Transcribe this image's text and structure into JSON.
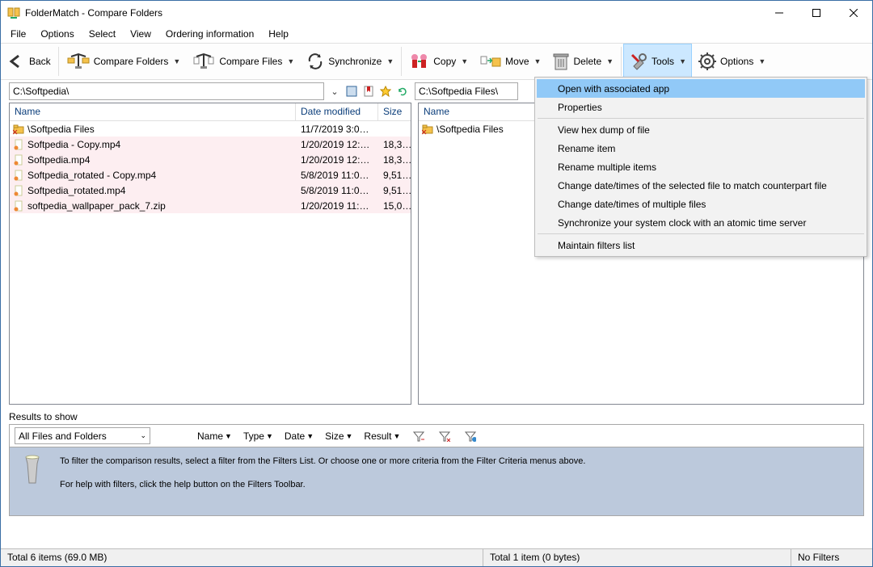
{
  "window": {
    "title": "FolderMatch - Compare Folders"
  },
  "menubar": [
    "File",
    "Options",
    "Select",
    "View",
    "Ordering information",
    "Help"
  ],
  "toolbar": {
    "back": "Back",
    "compare_folders": "Compare Folders",
    "compare_files": "Compare Files",
    "synchronize": "Synchronize",
    "copy": "Copy",
    "move": "Move",
    "delete": "Delete",
    "tools": "Tools",
    "options": "Options"
  },
  "paths": {
    "left": "C:\\Softpedia\\",
    "right": "C:\\Softpedia Files\\"
  },
  "columns": {
    "name": "Name",
    "date": "Date modified",
    "size": "Size"
  },
  "left_rows": [
    {
      "type": "folder",
      "name": "\\Softpedia Files",
      "date": "11/7/2019 3:0…",
      "size": ""
    },
    {
      "type": "file",
      "name": "Softpedia - Copy.mp4",
      "date": "1/20/2019 12:…",
      "size": "18,3…"
    },
    {
      "type": "file",
      "name": "Softpedia.mp4",
      "date": "1/20/2019 12:…",
      "size": "18,3…"
    },
    {
      "type": "file",
      "name": "Softpedia_rotated - Copy.mp4",
      "date": "5/8/2019 11:0…",
      "size": "9,51…"
    },
    {
      "type": "file",
      "name": "Softpedia_rotated.mp4",
      "date": "5/8/2019 11:0…",
      "size": "9,51…"
    },
    {
      "type": "file",
      "name": "softpedia_wallpaper_pack_7.zip",
      "date": "1/20/2019 11:…",
      "size": "15,0…"
    }
  ],
  "right_rows": [
    {
      "type": "folder",
      "name": "\\Softpedia Files"
    }
  ],
  "results": {
    "section_label": "Results to show",
    "select_value": "All Files and Folders",
    "chips": [
      "Name",
      "Type",
      "Date",
      "Size",
      "Result"
    ],
    "hint1": "To filter the comparison results, select a filter from the Filters List. Or choose one or more criteria from the Filter Criteria menus above.",
    "hint2": "For help with filters, click the help button on the Filters Toolbar."
  },
  "status": {
    "left": "Total 6 items (69.0 MB)",
    "right": "Total 1 item (0 bytes)",
    "filters": "No Filters"
  },
  "tools_menu": [
    "Open with associated app",
    "Properties",
    "-",
    "View hex dump of file",
    "Rename item",
    "Rename multiple items",
    "Change date/times of the selected file to match counterpart file",
    "Change date/times of multiple files",
    "Synchronize your system clock with an atomic time server",
    "-",
    "Maintain filters list"
  ]
}
